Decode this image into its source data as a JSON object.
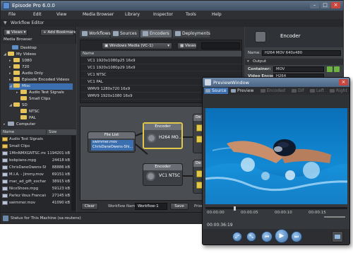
{
  "app": {
    "title": "Episode Pro 6.0.0",
    "menu": [
      "File",
      "Edit",
      "View",
      "Media Browser",
      "Library",
      "Inspector",
      "Tools",
      "Help"
    ],
    "workflow_editor_label": "Workflow Editor"
  },
  "media_browser": {
    "views_label": "Views",
    "add_bookmark_label": "Add Bookmark",
    "header": "Media Browser",
    "tree": [
      {
        "label": "Desktop",
        "level": 1
      },
      {
        "label": "My Videos",
        "level": 0
      },
      {
        "label": "1080",
        "level": 1
      },
      {
        "label": "720",
        "level": 1
      },
      {
        "label": "Audio Only",
        "level": 1
      },
      {
        "label": "Episode Encoded Videos",
        "level": 1
      },
      {
        "label": "Misc",
        "level": 1
      },
      {
        "label": "Audio Test Signals",
        "level": 2
      },
      {
        "label": "Small Clips",
        "level": 2
      },
      {
        "label": "SD",
        "level": 1
      },
      {
        "label": "NTSC",
        "level": 2
      },
      {
        "label": "PAL",
        "level": 2
      },
      {
        "label": "Computer",
        "level": 0
      }
    ],
    "columns": {
      "name": "Name",
      "size": "Size"
    },
    "folders": [
      "Audio Test Signals",
      "Small Clips"
    ],
    "files": [
      {
        "name": "1MinNMXGNTSC.mov",
        "size": "1194201 kB"
      },
      {
        "name": "bobpiano.mpg",
        "size": "24418 kB"
      },
      {
        "name": "ChrisDaneOwens-Shi...",
        "size": "88886 kB"
      },
      {
        "name": "M.I.A. - Jimmy.mov",
        "size": "69151 kB"
      },
      {
        "name": "mac_ad_gift_exchang...",
        "size": "38915 kB"
      },
      {
        "name": "NiceShoes.mpg",
        "size": "59123 kB"
      },
      {
        "name": "Parlez Vous Francais...",
        "size": "27145 kB"
      },
      {
        "name": "swimmer.mov",
        "size": "41090 kB"
      }
    ],
    "status": "Status for This Machine (sa-reutens)"
  },
  "workflow": {
    "tabs": [
      "Workflows",
      "Sources",
      "Encoders",
      "Deployments"
    ],
    "active_tab": "Encoders",
    "format_select": "Windows Media (VC-1)",
    "views_label": "Views",
    "list_header": "Name",
    "encoders": [
      "VC1 1920x1080p25 16x9",
      "VC1 1920x1080p29 16x9",
      "VC1 NTSC",
      "VC1 PAL",
      "WMV9 1280x720 16x9",
      "WMV9 1920x1080 16x9"
    ],
    "file_list_node": {
      "title": "File List",
      "items": [
        "swimmer.mov",
        "ChrisDaneOwens-Shine..."
      ]
    },
    "encoder_nodes": [
      {
        "title": "Encoder",
        "label": "H264 MOV 64..."
      },
      {
        "title": "Encoder",
        "label": "VC1 NTSC"
      }
    ],
    "deploy_header": "De",
    "clear_label": "Clear",
    "workflow_name_label": "Workflow Name:",
    "workflow_name_value": "Workflow-1",
    "save_label": "Save",
    "priority_label": "Priority"
  },
  "inspector": {
    "title": "Encoder",
    "name_label": "Name:",
    "name_value": "H264 MOV 640x480",
    "section": "Output",
    "container_label": "Container:",
    "container_value": "MOV",
    "video_encoder_label": "Video Encoder:",
    "video_encoder_value": "H264"
  },
  "preview": {
    "title": "PreviewWindow",
    "tabs": [
      "Source",
      "Preview",
      "Encoded",
      "Dif",
      "Left",
      "Right"
    ],
    "timecodes": [
      "00:00:00",
      "00:00:05",
      "00:00:10",
      "00:00:15"
    ],
    "current_time": "00:00:36:19"
  },
  "colors": {
    "accent_yellow": "#e3c94a",
    "selection_blue": "#3b6fb0",
    "node_green": "#6db33f"
  }
}
